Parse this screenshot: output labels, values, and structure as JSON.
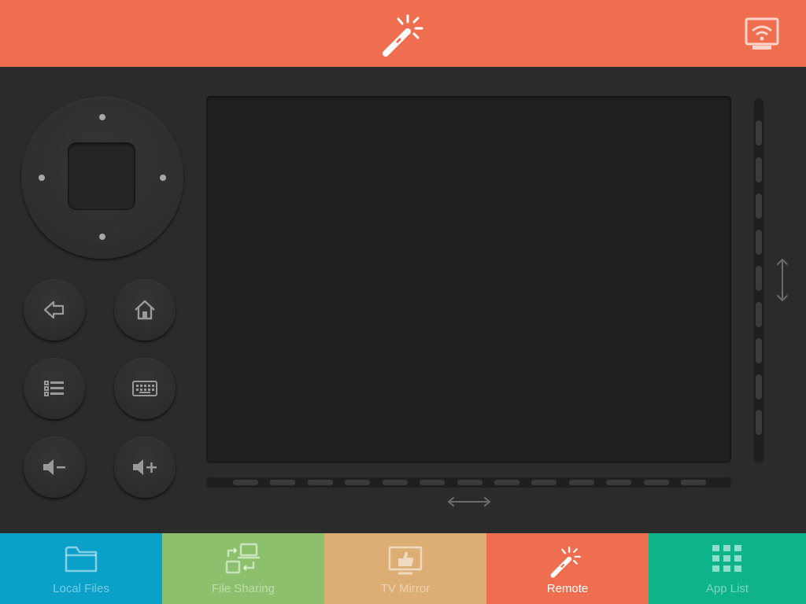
{
  "colors": {
    "header": "#f06e50",
    "background": "#2b2b2c",
    "tab_local_files": "#0aa0c8",
    "tab_file_sharing": "#8cc06c",
    "tab_tv_mirror": "#dcae74",
    "tab_remote": "#f06e50",
    "tab_app_list": "#0fb38a"
  },
  "header": {
    "center_icon": "magic-wand-icon",
    "right_icon": "wifi-cast-icon"
  },
  "remote": {
    "dpad_center_icon": "ok-button",
    "buttons": [
      {
        "icon": "back-arrow-icon"
      },
      {
        "icon": "home-icon"
      },
      {
        "icon": "menu-list-icon"
      },
      {
        "icon": "keyboard-icon"
      },
      {
        "icon": "volume-down-icon"
      },
      {
        "icon": "volume-up-icon"
      }
    ],
    "touchpad_icon_vertical": "vertical-scroll-arrow-icon",
    "touchpad_icon_horizontal": "horizontal-scroll-arrow-icon"
  },
  "tabs": [
    {
      "label": "Local Files",
      "icon": "folder-icon",
      "active": false
    },
    {
      "label": "File Sharing",
      "icon": "file-sharing-icon",
      "active": false
    },
    {
      "label": "TV Mirror",
      "icon": "tv-mirror-icon",
      "active": false
    },
    {
      "label": "Remote",
      "icon": "magic-wand-icon",
      "active": true
    },
    {
      "label": "App List",
      "icon": "app-grid-icon",
      "active": false
    }
  ]
}
